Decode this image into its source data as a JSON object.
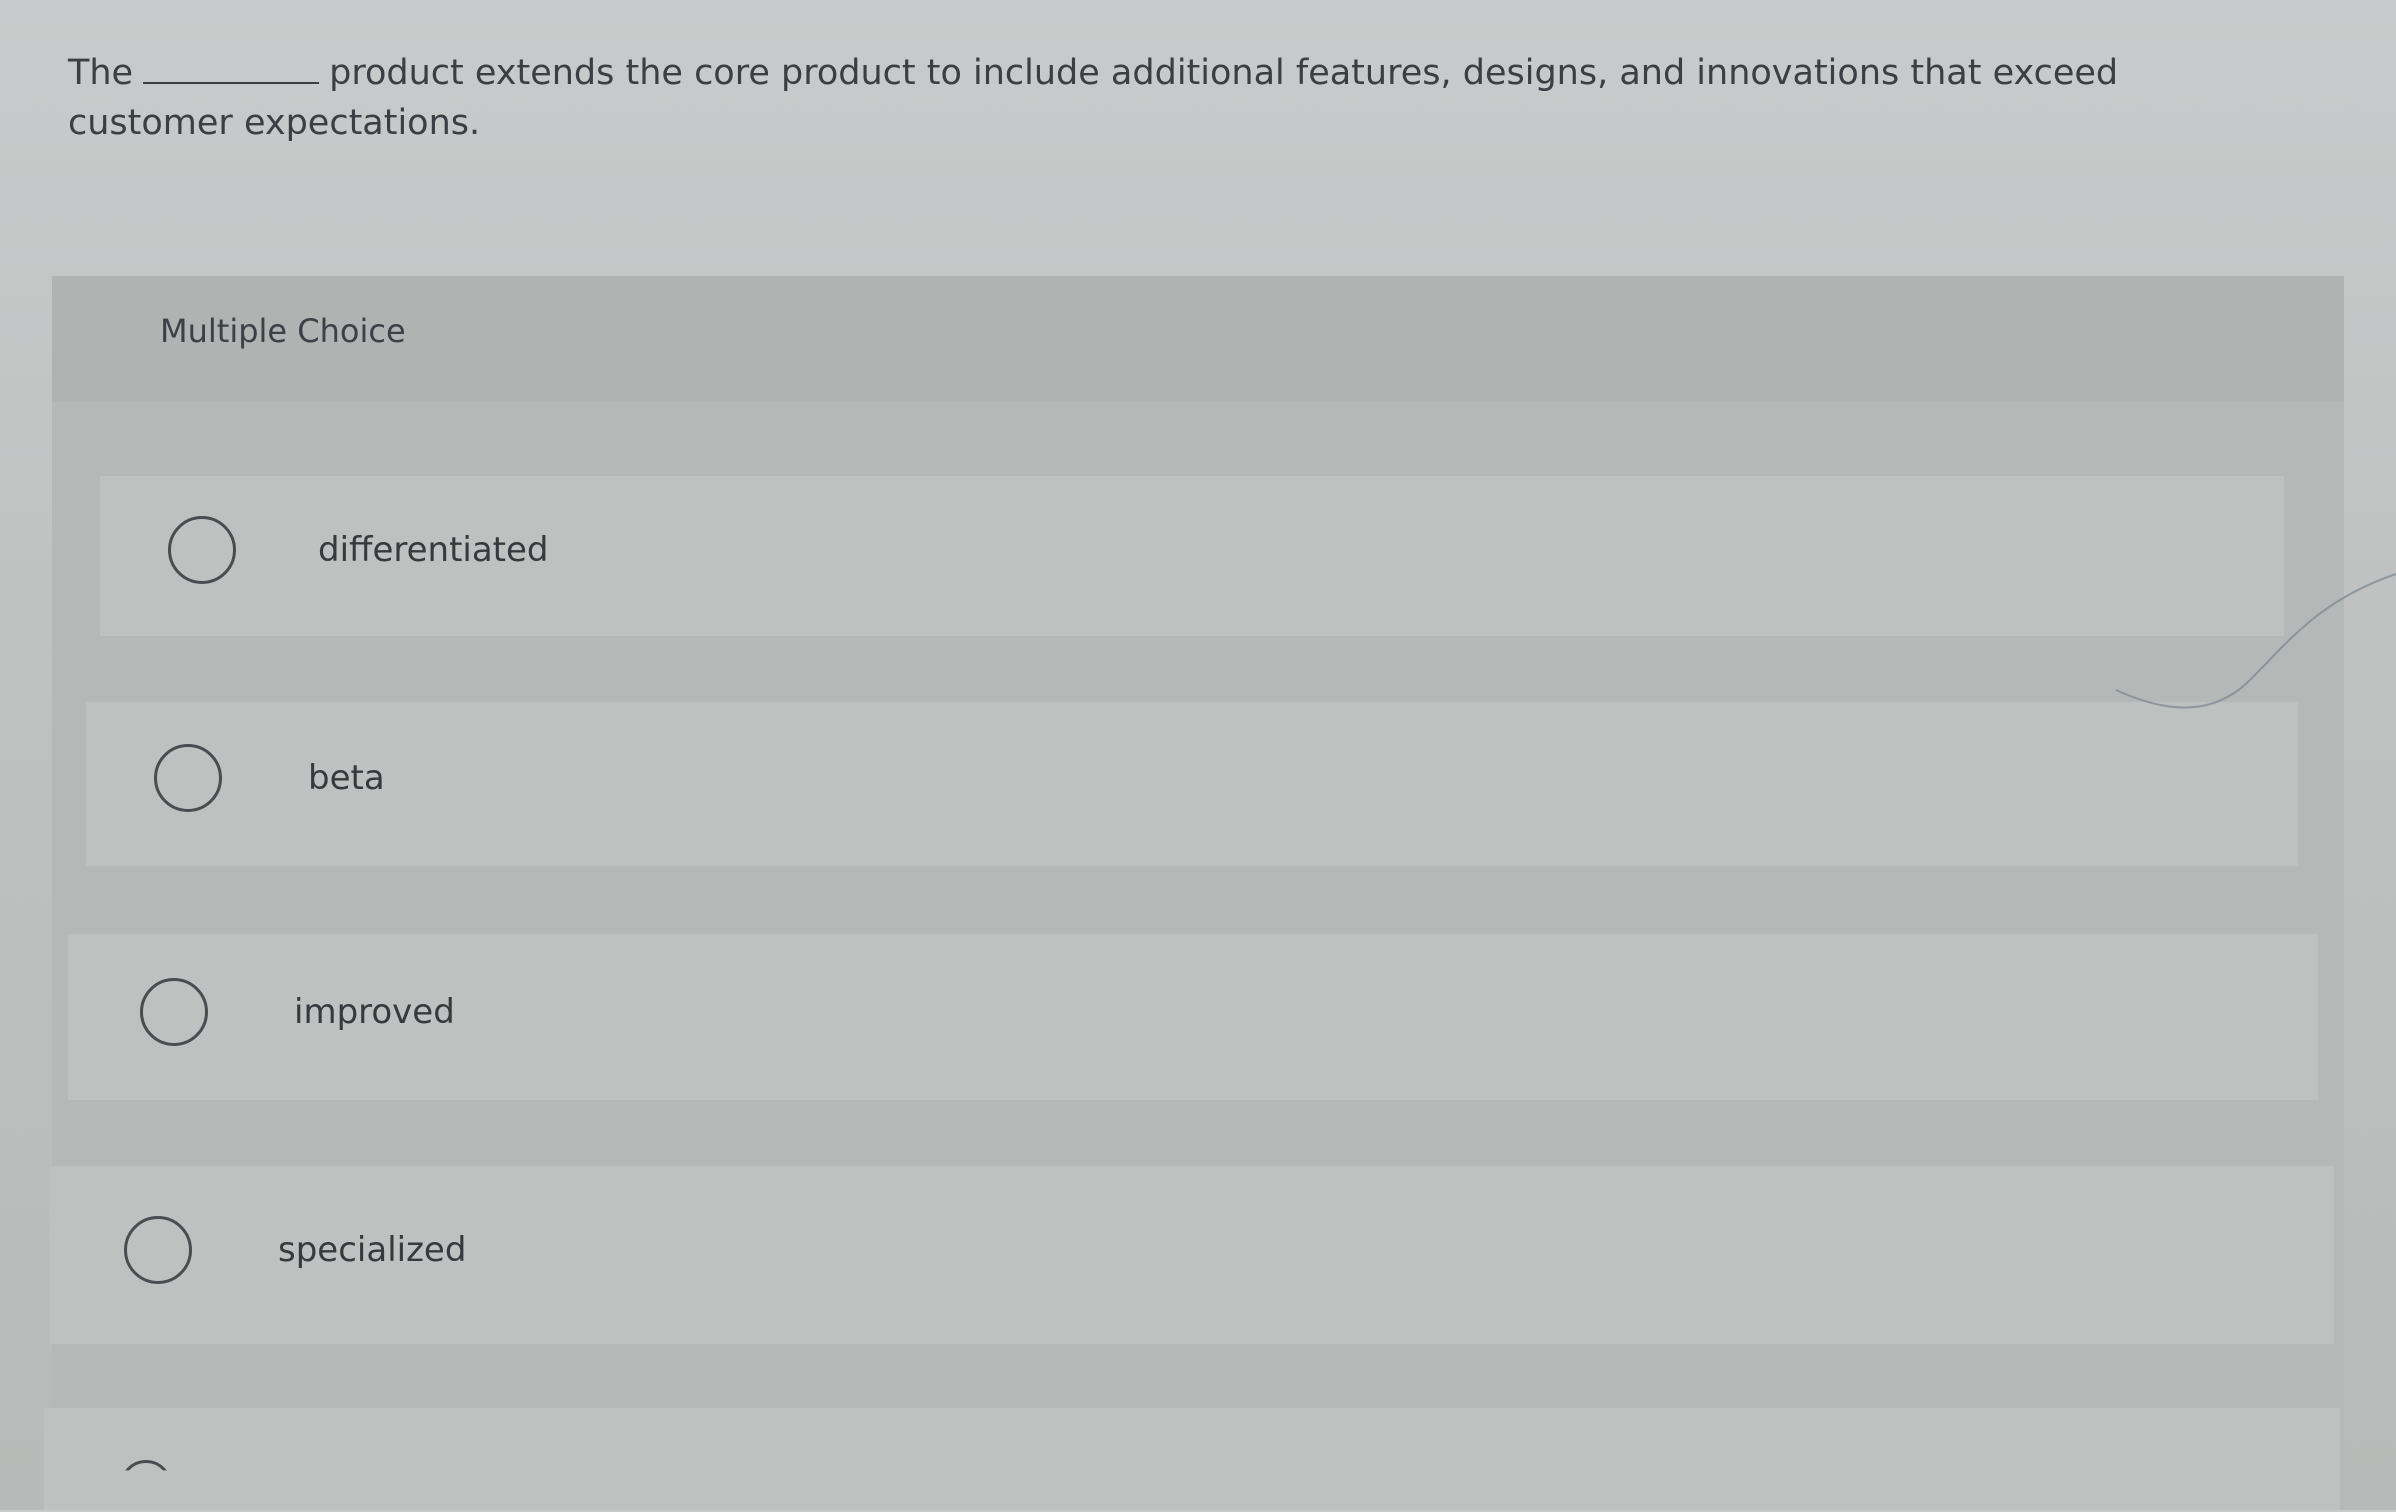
{
  "question": {
    "prefix": "The",
    "suffix": "product extends the core product to include additional features, designs, and innovations that exceed customer expectations."
  },
  "card": {
    "title": "Multiple Choice"
  },
  "options": [
    {
      "label": "differentiated"
    },
    {
      "label": "beta"
    },
    {
      "label": "improved"
    },
    {
      "label": "specialized"
    }
  ],
  "colors": {
    "background": "#c8cbcb",
    "card": "#b4b8b7",
    "option": "#bdc1c0",
    "text": "#3b3e42"
  }
}
